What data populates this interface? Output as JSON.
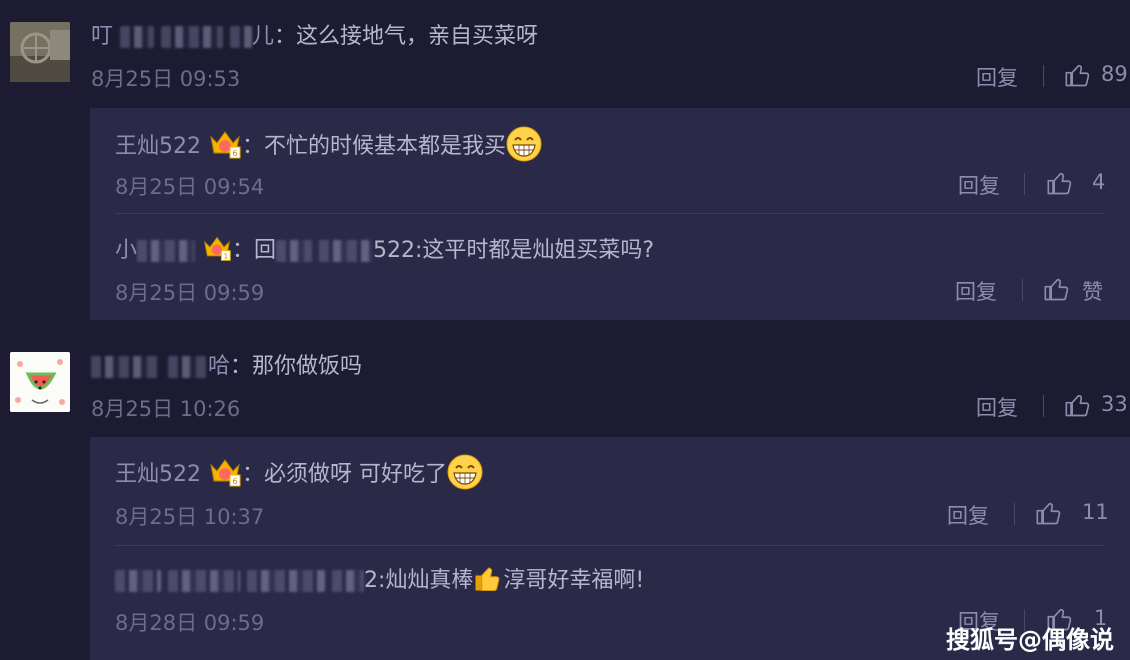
{
  "comments": [
    {
      "user_prefix": "叮",
      "user_suffix": "儿",
      "text": "：这么接地气，亲自买菜呀",
      "date": "8月25日 09:53",
      "reply_label": "回复",
      "likes": "89"
    },
    {
      "user_suffix": "哈",
      "text": "：那你做饭吗",
      "date": "8月25日 10:26",
      "reply_label": "回复",
      "likes": "33"
    }
  ],
  "replies": [
    {
      "user": "王灿522",
      "text": "：不忙的时候基本都是我买",
      "date": "8月25日 09:54",
      "reply_label": "回复",
      "likes": "4"
    },
    {
      "user_prefix": "小",
      "text_prefix": "：回",
      "text": "522:这平时都是灿姐买菜吗?",
      "date": "8月25日 09:59",
      "reply_label": "回复",
      "likes": "赞"
    },
    {
      "user": "王灿522",
      "text": "：必须做呀 可好吃了",
      "date": "8月25日 10:37",
      "reply_label": "回复",
      "likes": "11"
    },
    {
      "text_a": "2:灿灿真棒",
      "text_b": "淳哥好幸福啊!",
      "date": "8月28日 09:59",
      "reply_label": "回复",
      "likes": "1"
    }
  ],
  "watermark": "搜狐号@偶像说",
  "icons": {
    "like": "thumbs-up-icon",
    "vip": "crown-icon",
    "grin": "grinning-face-emoji",
    "thumb": "thumbs-up-emoji"
  },
  "colors": {
    "background": "#1c1b31",
    "reply_background": "#2a2948",
    "text": "#b7b5cc",
    "muted": "#6e6c8d"
  }
}
